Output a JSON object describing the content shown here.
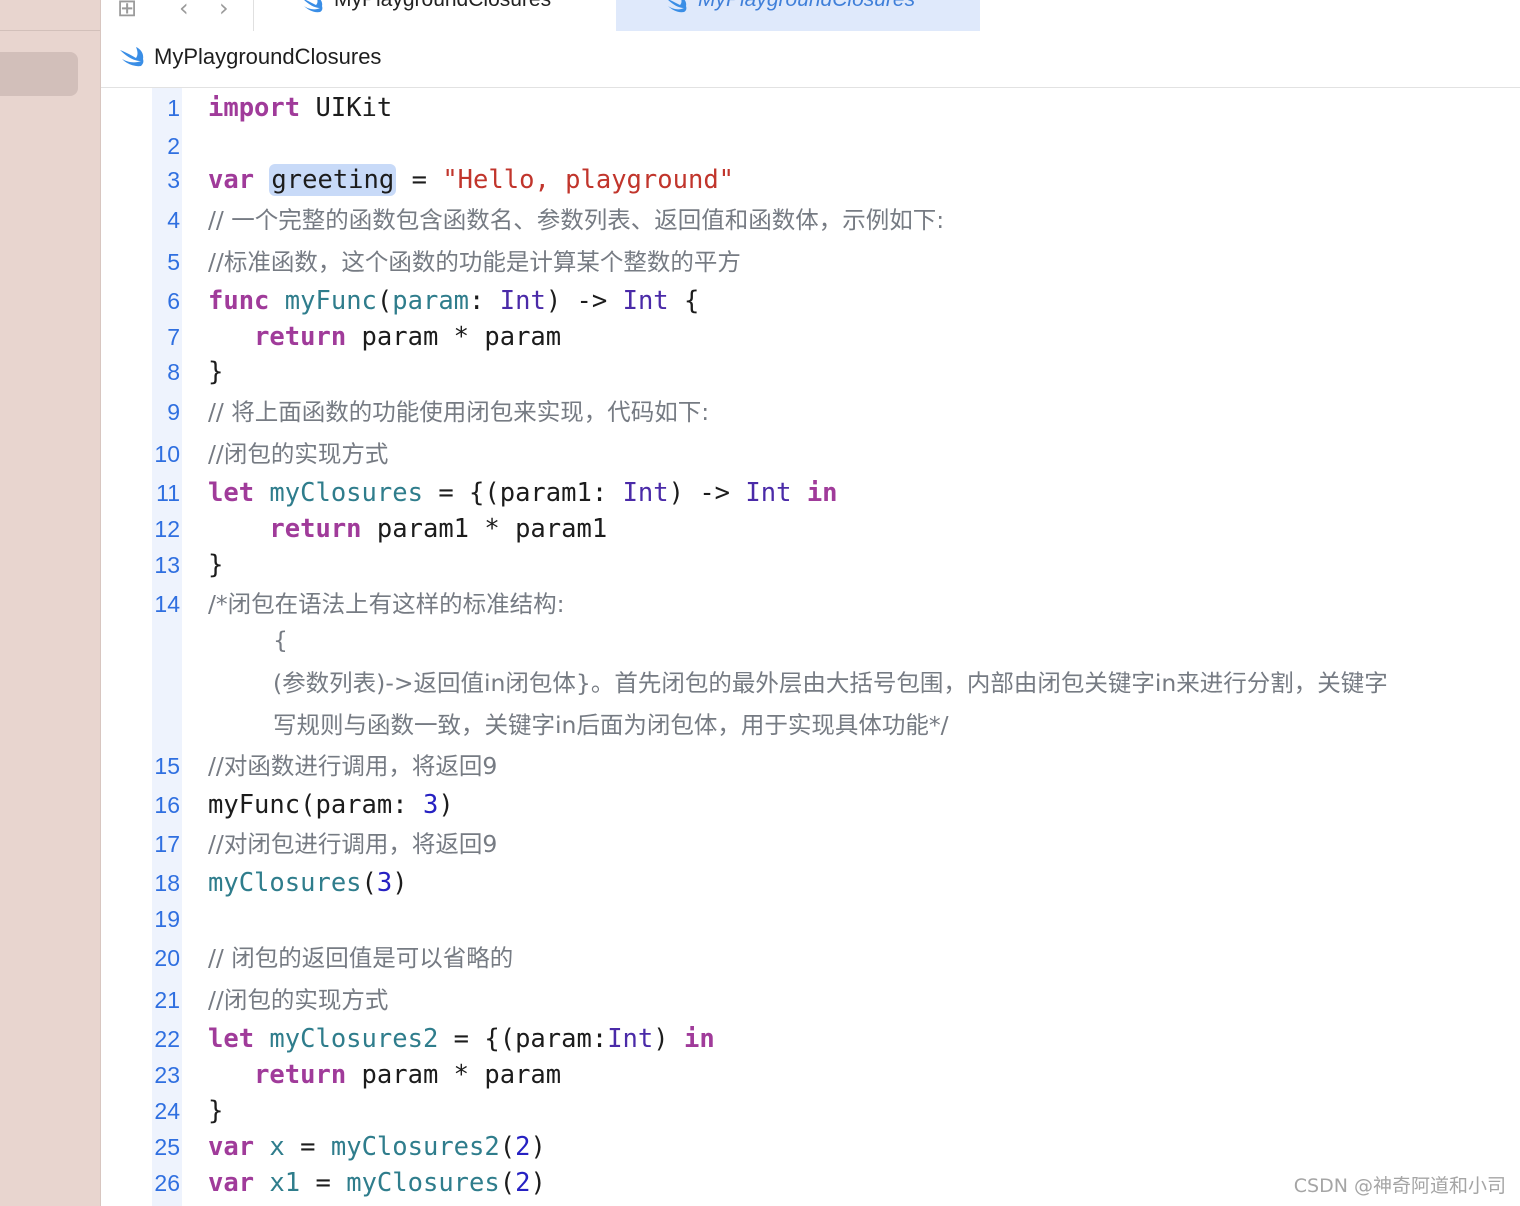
{
  "tabs": [
    {
      "label": "MyPlaygroundClosures"
    },
    {
      "label": "MyPlaygroundClosures"
    }
  ],
  "breadcrumb": {
    "label": "MyPlaygroundClosures"
  },
  "icons": {
    "grid": "grid-icon",
    "back": "chevron-left-icon",
    "forward": "chevron-right-icon",
    "file": "swift-icon"
  },
  "colors": {
    "keyword": "#a03b9a",
    "type": "#4a2aa8",
    "function": "#2f7d8c",
    "string": "#c1352c",
    "number": "#2621c2",
    "comment": "#767b83",
    "line_number": "#2f6fe0"
  },
  "code": {
    "line_numbers": [
      "1",
      "2",
      "3",
      "4",
      "5",
      "6",
      "7",
      "8",
      "9",
      "10",
      "11",
      "12",
      "13",
      "14",
      "15",
      "16",
      "17",
      "18",
      "19",
      "20",
      "21",
      "22",
      "23",
      "24",
      "25",
      "26"
    ],
    "t": {
      "import": "import",
      "uikit": "UIKit",
      "var": "var",
      "greeting": "greeting",
      "eq": "=",
      "hello": "\"Hello, playground\"",
      "c4": "// 一个完整的函数包含函数名、参数列表、返回值和函数体，示例如下:",
      "c5": "//标准函数，这个函数的功能是计算某个整数的平方",
      "func": "func",
      "myFunc": "myFunc",
      "open_paren": "(",
      "param": "param",
      "colon": ":",
      "int": "Int",
      "arrow_close": ") ->",
      "brace_open": "{",
      "return": "return",
      "param_mul": "param * param",
      "brace_close": "}",
      "c9": "// 将上面函数的功能使用闭包来实现，代码如下:",
      "c10": "//闭包的实现方式",
      "let": "let",
      "myClosures": "myClosures",
      "open_block": "= {(param1:",
      "close_arrow": ") ->",
      "in": "in",
      "param1_mul": "param1 * param1",
      "c14": "/*闭包在语法上有这样的标准结构:",
      "c14b": "{",
      "c14c": "(参数列表)->返回值in闭包体}。首先闭包的最外层由大括号包围，内部由闭包关键字in来进行分割，关键字",
      "c14d": "写规则与函数一致，关键字in后面为闭包体，用于实现具体功能*/",
      "c15": "//对函数进行调用，将返回9",
      "call1_a": "myFunc(param:",
      "three": "3",
      "close": ")",
      "c17": "//对闭包进行调用，将返回9",
      "call2": "myClosures",
      "open": "(",
      "c20": "// 闭包的返回值是可以省略的",
      "c21": "//闭包的实现方式",
      "myClosures2": "myClosures2",
      "open_block2": "= {(param:",
      "close2": ")",
      "x": "x",
      "x1": "x1",
      "two": "2"
    }
  },
  "watermark": "CSDN @神奇阿道和小司"
}
